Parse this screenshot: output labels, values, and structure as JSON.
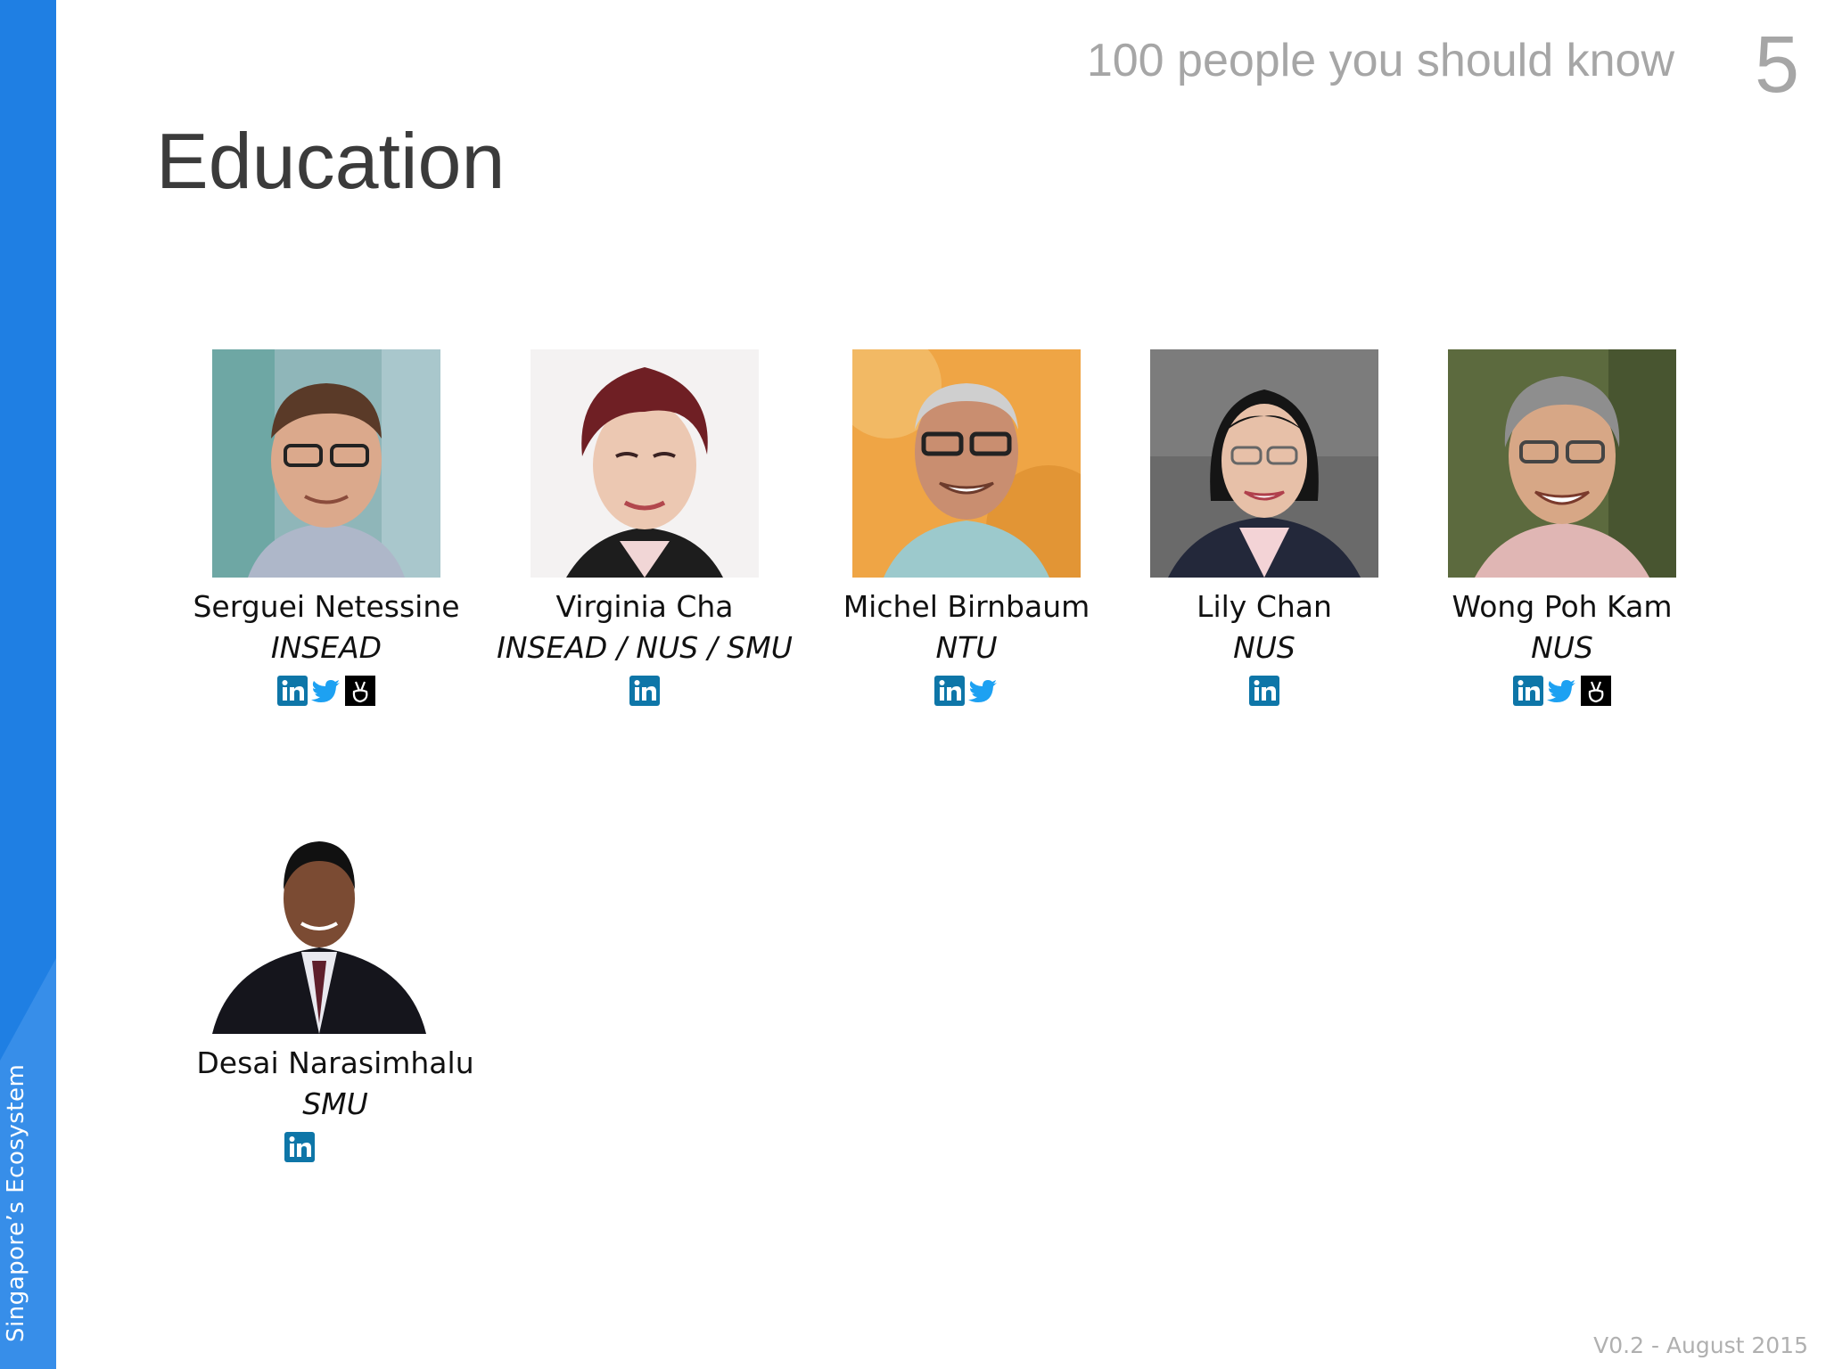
{
  "sidebar": {
    "label": "Singapore’s Ecosystem"
  },
  "header": {
    "deck_title": "100 people you should know",
    "page_number": "5"
  },
  "slide": {
    "title": "Education"
  },
  "people": [
    {
      "name": "Serguei Netessine",
      "org": "INSEAD",
      "icons": [
        "linkedin-icon",
        "twitter-icon",
        "angellist-icon"
      ]
    },
    {
      "name": "Virginia Cha",
      "org": "INSEAD / NUS / SMU",
      "icons": [
        "linkedin-icon"
      ]
    },
    {
      "name": "Michel Birnbaum",
      "org": "NTU",
      "icons": [
        "linkedin-icon",
        "twitter-icon"
      ]
    },
    {
      "name": "Lily Chan",
      "org": "NUS",
      "icons": [
        "linkedin-icon"
      ]
    },
    {
      "name": "Wong Poh Kam",
      "org": "NUS",
      "icons": [
        "linkedin-icon",
        "twitter-icon",
        "angellist-icon"
      ]
    },
    {
      "name": "Desai Narasimhalu",
      "org": "SMU",
      "icons": [
        "linkedin-icon"
      ]
    }
  ],
  "footer": {
    "version": "V0.2 - August 2015"
  },
  "colors": {
    "sidebar": "#1f7fe3",
    "linkedin": "#0e76a8",
    "twitter": "#1da1f2"
  }
}
